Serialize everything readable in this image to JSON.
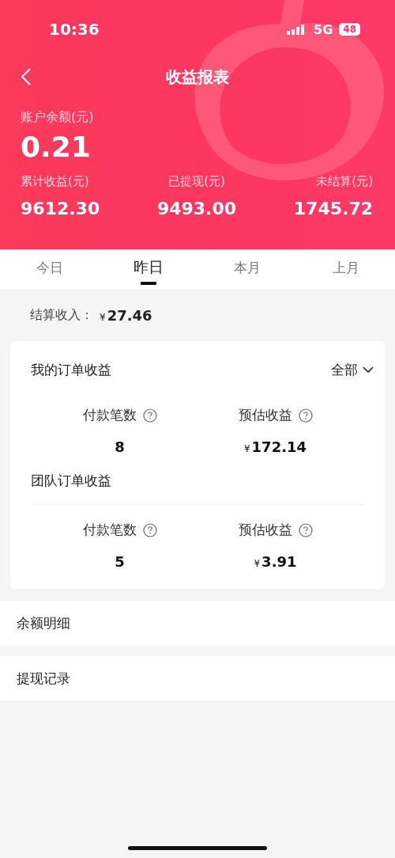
{
  "status_bar": {
    "time": "10:36",
    "network": "5G",
    "battery": "48"
  },
  "nav": {
    "title": "收益报表"
  },
  "balance": {
    "label": "账户余额(元)",
    "value": "0.21"
  },
  "stats": [
    {
      "label": "累计收益(元)",
      "value": "9612.30"
    },
    {
      "label": "已提现(元)",
      "value": "9493.00"
    },
    {
      "label": "未结算(元)",
      "value": "1745.72"
    }
  ],
  "tabs": [
    {
      "label": "今日",
      "selected": false
    },
    {
      "label": "昨日",
      "selected": true
    },
    {
      "label": "本月",
      "selected": false
    },
    {
      "label": "上月",
      "selected": false
    }
  ],
  "settlement": {
    "label": "结算收入：",
    "currency": "¥",
    "amount": "27.46"
  },
  "card": {
    "filter": "全部",
    "sections": [
      {
        "title": "我的订单收益",
        "metrics": [
          {
            "label": "付款笔数",
            "value": "8"
          },
          {
            "label": "预估收益",
            "currency": "¥",
            "value": "172.14"
          }
        ]
      },
      {
        "title": "团队订单收益",
        "metrics": [
          {
            "label": "付款笔数",
            "value": "5"
          },
          {
            "label": "预估收益",
            "currency": "¥",
            "value": "3.91"
          }
        ]
      }
    ]
  },
  "links": [
    "余额明细",
    "提现记录"
  ]
}
